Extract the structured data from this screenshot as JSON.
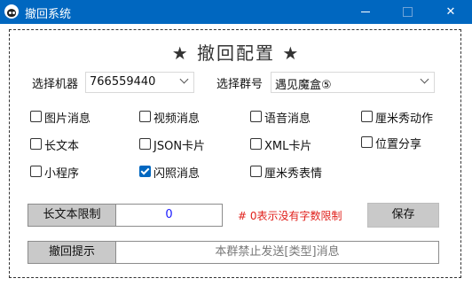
{
  "window": {
    "title": "撤回系统",
    "minimize_glyph": "",
    "close_glyph": "✕"
  },
  "icons": {
    "app": "penguin-icon",
    "minimize": "minimize-icon",
    "maximize": "maximize-icon",
    "close": "close-icon"
  },
  "header": {
    "title": "★ 撤回配置 ★"
  },
  "selectors": {
    "robot_label": "选择机器",
    "robot_value": "766559440",
    "group_label": "选择群号",
    "group_value": "遇见魔盒⑤"
  },
  "options": [
    {
      "label": "图片消息",
      "checked": false
    },
    {
      "label": "视频消息",
      "checked": false
    },
    {
      "label": "语音消息",
      "checked": false
    },
    {
      "label": "厘米秀动作",
      "checked": false
    },
    {
      "label": "长文本",
      "checked": false
    },
    {
      "label": "JSON卡片",
      "checked": false
    },
    {
      "label": "XML卡片",
      "checked": false
    },
    {
      "label": "位置分享",
      "checked": false
    },
    {
      "label": "小程序",
      "checked": false
    },
    {
      "label": "闪照消息",
      "checked": true
    },
    {
      "label": "厘米秀表情",
      "checked": false
    }
  ],
  "limit": {
    "label": "长文本限制",
    "value": "0",
    "note": "# 0表示没有字数限制"
  },
  "save_label": "保存",
  "prompt": {
    "label": "撤回提示",
    "value": "本群禁止发送[类型]消息"
  },
  "colors": {
    "titlebar": "#0067c0",
    "checked": "#0067c0",
    "note": "#e0201b",
    "value_blue": "#1a1aff"
  }
}
